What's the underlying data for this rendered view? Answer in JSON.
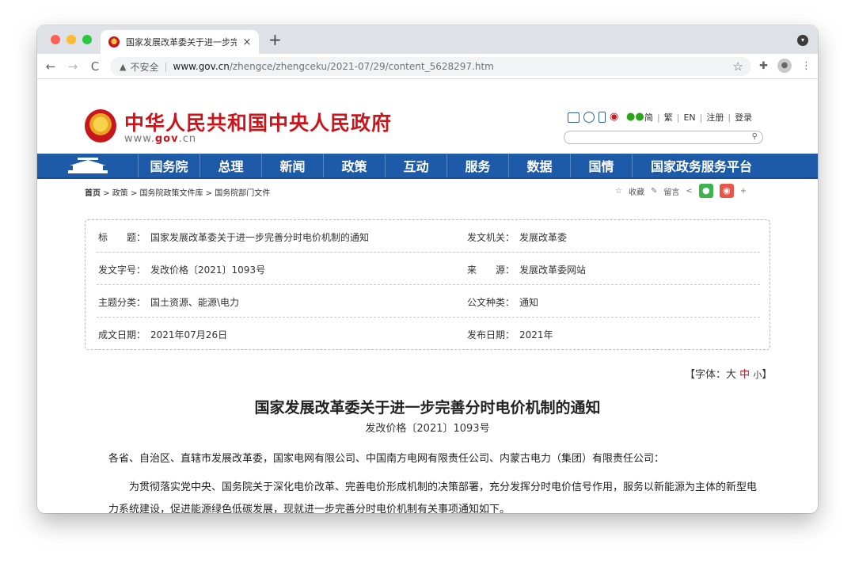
{
  "browser": {
    "tab_title": "国家发展改革委关于进一步完善",
    "tab_close": "×",
    "new_tab": "+",
    "back": "←",
    "forward": "→",
    "reload": "C",
    "security_label": "不安全",
    "url_host": "www.gov.cn",
    "url_path": "/zhengce/zhengceku/2021-07/29/content_5628297.htm",
    "bookmark_star": "☆",
    "menu": "⋮"
  },
  "site": {
    "title": "中华人民共和国中央人民政府",
    "domain_prefix": "www.",
    "domain_mid": "gov",
    "domain_suffix": ".cn",
    "util_links": [
      "简",
      "繁",
      "EN",
      "注册",
      "登录"
    ],
    "util_sep": "|"
  },
  "nav": {
    "items": [
      "国务院",
      "总理",
      "新闻",
      "政策",
      "互动",
      "服务",
      "数据",
      "国情"
    ],
    "wide_item": "国家政务服务平台"
  },
  "breadcrumb": {
    "home": "首页",
    "path": " > 政策 > 国务院政策文件库 > 国务院部门文件"
  },
  "share": {
    "favorite": "收藏",
    "comment": "留言",
    "more": "+"
  },
  "info": {
    "rows": [
      {
        "k": "标　　题：",
        "v": "国家发展改革委关于进一步完善分时电价机制的通知",
        "k2": "发文机关：",
        "v2": "发展改革委"
      },
      {
        "k": "发文字号：",
        "v": "发改价格〔2021〕1093号",
        "k2": "来　　源：",
        "v2": "发展改革委网站"
      },
      {
        "k": "主题分类：",
        "v": "国土资源、能源\\电力",
        "k2": "公文种类：",
        "v2": "通知"
      },
      {
        "k": "成文日期：",
        "v": "2021年07月26日",
        "k2": "发布日期：",
        "v2": "2021年"
      }
    ]
  },
  "font_size": {
    "open": "【字体：",
    "large": "大",
    "medium": "中",
    "small": "小",
    "close": "】"
  },
  "doc": {
    "title": "国家发展改革委关于进一步完善分时电价机制的通知",
    "number": "发改价格〔2021〕1093号",
    "recipients": "各省、自治区、直辖市发展改革委，国家电网有限公司、中国南方电网有限责任公司、内蒙古电力（集团）有限责任公司：",
    "para1": "为贯彻落实党中央、国务院关于深化电价改革、完善电价形成机制的决策部署，充分发挥分时电价信号作用，服务以新能源为主体的新型电力系统建设，促进能源绿色低碳发展，现就进一步完善分时电价机制有关事项通知如下。"
  },
  "colors": {
    "brand_red": "#c8161d",
    "nav_blue": "#1d5ba8"
  }
}
